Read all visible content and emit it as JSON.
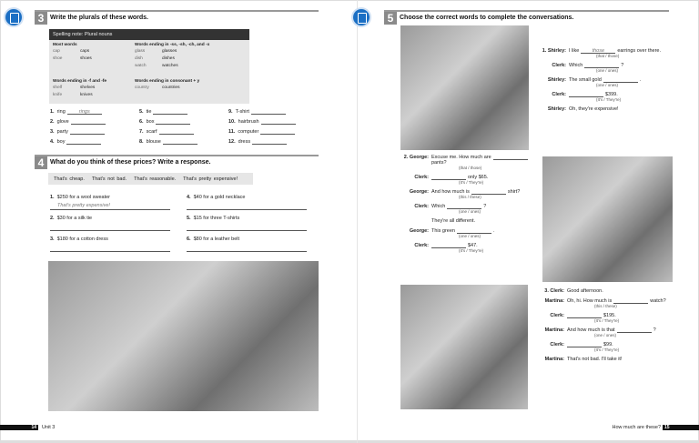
{
  "left": {
    "section3": {
      "number": "3",
      "title": "Write the plurals of these words.",
      "note_title": "Spelling note: Plural nouns",
      "groups": [
        {
          "head": "Most words",
          "pairs": [
            [
              "cap",
              "caps"
            ],
            [
              "shoe",
              "shoes"
            ]
          ]
        },
        {
          "head": "Words ending in -ss, -sh, -ch, and -x",
          "pairs": [
            [
              "glass",
              "glasses"
            ],
            [
              "dish",
              "dishes"
            ],
            [
              "watch",
              "watches"
            ]
          ]
        },
        {
          "head": "Words ending in -f and -fe",
          "pairs": [
            [
              "shelf",
              "shelves"
            ],
            [
              "knife",
              "knives"
            ]
          ]
        },
        {
          "head": "Words ending in consonant + y",
          "pairs": [
            [
              "country",
              "countries"
            ]
          ]
        }
      ],
      "items": [
        {
          "n": "1.",
          "w": "ring",
          "a": "rings"
        },
        {
          "n": "2.",
          "w": "glove",
          "a": ""
        },
        {
          "n": "3.",
          "w": "party",
          "a": ""
        },
        {
          "n": "4.",
          "w": "boy",
          "a": ""
        },
        {
          "n": "5.",
          "w": "tie",
          "a": ""
        },
        {
          "n": "6.",
          "w": "box",
          "a": ""
        },
        {
          "n": "7.",
          "w": "scarf",
          "a": ""
        },
        {
          "n": "8.",
          "w": "blouse",
          "a": ""
        },
        {
          "n": "9.",
          "w": "T-shirt",
          "a": ""
        },
        {
          "n": "10.",
          "w": "hairbrush",
          "a": ""
        },
        {
          "n": "11.",
          "w": "computer",
          "a": ""
        },
        {
          "n": "12.",
          "w": "dress",
          "a": ""
        }
      ]
    },
    "section4": {
      "number": "4",
      "title": "What do you think of these prices? Write a response.",
      "phrases": [
        "That's cheap.",
        "That's not bad.",
        "That's reasonable.",
        "That's pretty expensive!"
      ],
      "items": [
        {
          "n": "1.",
          "t": "$250 for a wool sweater",
          "a": "That's pretty expensive!"
        },
        {
          "n": "2.",
          "t": "$30 for a silk tie",
          "a": ""
        },
        {
          "n": "3.",
          "t": "$180 for a cotton dress",
          "a": ""
        },
        {
          "n": "4.",
          "t": "$40 for a gold necklace",
          "a": ""
        },
        {
          "n": "5.",
          "t": "$15 for three T-shirts",
          "a": ""
        },
        {
          "n": "6.",
          "t": "$80 for a leather belt",
          "a": ""
        }
      ]
    },
    "footer": {
      "page": "14",
      "label": "Unit 3"
    }
  },
  "right": {
    "section5": {
      "number": "5",
      "title": "Choose the correct words to complete the conversations.",
      "conv1": [
        {
          "sp": "1. Shirley:",
          "pre": "I like",
          "ans": "those",
          "post": "earrings over there.",
          "hint": "(that / those)"
        },
        {
          "sp": "Clerk:",
          "pre": "Which",
          "ans": "",
          "post": "?",
          "hint": "(one / ones)"
        },
        {
          "sp": "Shirley:",
          "pre": "The small gold",
          "ans": "",
          "post": ".",
          "hint": "(one / ones)"
        },
        {
          "sp": "Clerk:",
          "pre": "",
          "ans": "",
          "post": "$399.",
          "hint": "(It's / They're)"
        },
        {
          "sp": "Shirley:",
          "pre": "Oh, they're expensive!",
          "ans": "",
          "post": "",
          "hint": ""
        }
      ],
      "conv2": [
        {
          "sp": "2. George:",
          "pre": "Excuse me. How much are",
          "ans": "",
          "post": "pants?",
          "hint": "(that / those)"
        },
        {
          "sp": "Clerk:",
          "pre": "",
          "ans": "",
          "post": "only $65.",
          "hint": "(It's / They're)"
        },
        {
          "sp": "George:",
          "pre": "And how much is",
          "ans": "",
          "post": "shirt?",
          "hint": "(this / these)"
        },
        {
          "sp": "Clerk:",
          "pre": "Which",
          "ans": "",
          "post": "?",
          "hint": "(one / ones)"
        },
        {
          "sp": "",
          "pre": "They're all different.",
          "ans": "",
          "post": "",
          "hint": ""
        },
        {
          "sp": "George:",
          "pre": "This green",
          "ans": "",
          "post": ".",
          "hint": "(one / ones)"
        },
        {
          "sp": "Clerk:",
          "pre": "",
          "ans": "",
          "post": "$47.",
          "hint": "(It's / They're)"
        }
      ],
      "conv3": [
        {
          "sp": "3. Clerk:",
          "pre": "Good afternoon.",
          "ans": "",
          "post": "",
          "hint": ""
        },
        {
          "sp": "Martina:",
          "pre": "Oh, hi. How much is",
          "ans": "",
          "post": "watch?",
          "hint": "(this / these)"
        },
        {
          "sp": "Clerk:",
          "pre": "",
          "ans": "",
          "post": "$195.",
          "hint": "(It's / They're)"
        },
        {
          "sp": "Martina:",
          "pre": "And how much is that",
          "ans": "",
          "post": "?",
          "hint": "(one / ones)"
        },
        {
          "sp": "Clerk:",
          "pre": "",
          "ans": "",
          "post": "$99.",
          "hint": "(It's / They're)"
        },
        {
          "sp": "Martina:",
          "pre": "That's not bad. I'll take it!",
          "ans": "",
          "post": "",
          "hint": ""
        }
      ]
    },
    "footer": {
      "page": "15",
      "label": "How much are these?"
    }
  }
}
